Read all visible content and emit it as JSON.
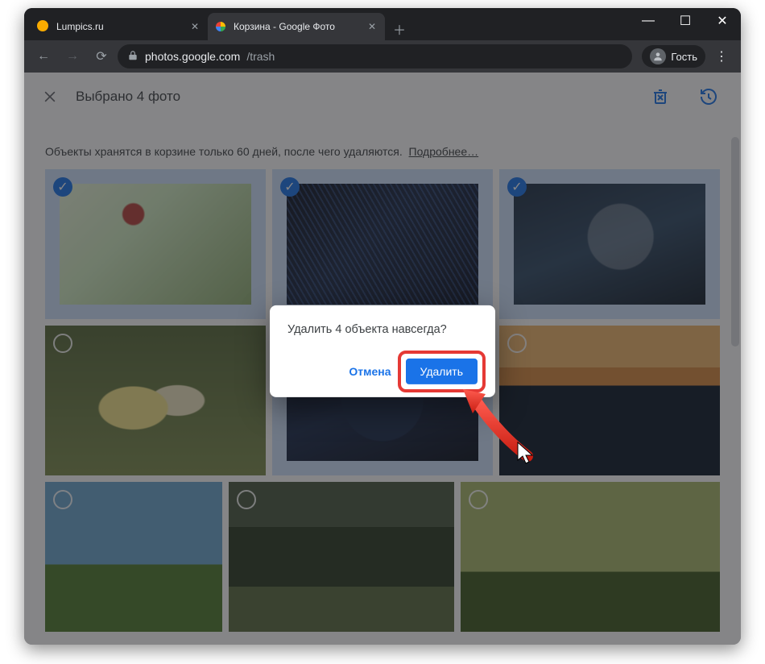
{
  "window": {
    "tabs": [
      {
        "label": "Lumpics.ru",
        "active": false
      },
      {
        "label": "Корзина - Google Фото",
        "active": true
      }
    ],
    "url_host": "photos.google.com",
    "url_path": "/trash",
    "profile_label": "Гость"
  },
  "appbar": {
    "title": "Выбрано 4 фото"
  },
  "notice": {
    "text": "Объекты хранятся в корзине только 60 дней, после чего удаляются.",
    "more_label": "Подробнее…"
  },
  "dialog": {
    "question": "Удалить 4 объекта навсегда?",
    "cancel_label": "Отмена",
    "confirm_label": "Удалить"
  },
  "photos": [
    {
      "selected": true,
      "cls": "p1"
    },
    {
      "selected": true,
      "cls": "p2"
    },
    {
      "selected": true,
      "cls": "p3"
    },
    {
      "selected": false,
      "cls": "p4"
    },
    {
      "selected": true,
      "cls": "p5"
    },
    {
      "selected": false,
      "cls": "p6"
    },
    {
      "selected": false,
      "cls": "p7"
    },
    {
      "selected": false,
      "cls": "p8"
    },
    {
      "selected": false,
      "cls": "p9"
    }
  ],
  "icons": {
    "close_x": "✕",
    "plus": "＋",
    "minimize": "—",
    "maximize": "☐",
    "winclose": "✕",
    "back": "←",
    "forward": "→",
    "reload": "⟳",
    "menu": "⋮",
    "check": "✓"
  },
  "colors": {
    "accent": "#1a73e8",
    "annotation": "#e53935"
  }
}
